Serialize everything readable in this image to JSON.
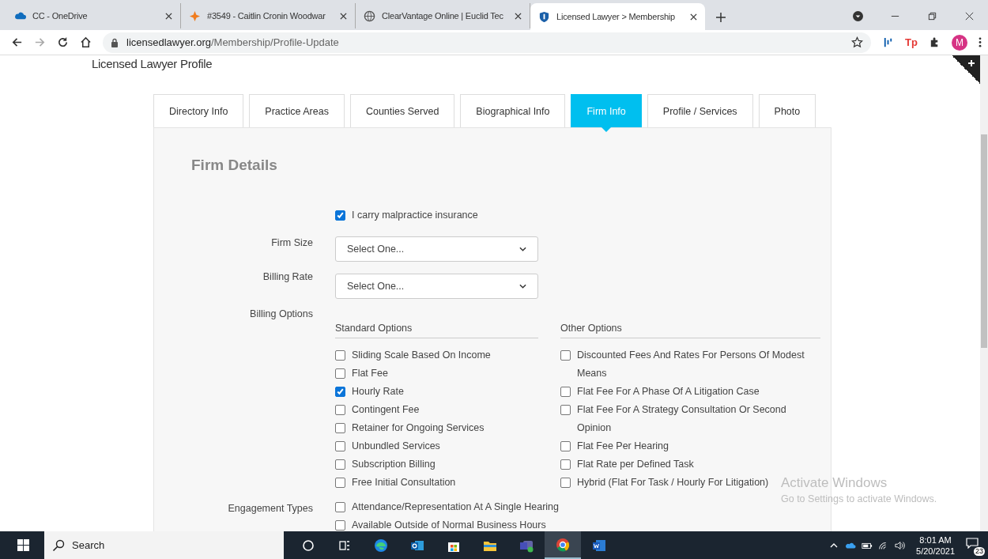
{
  "browser": {
    "tabs": [
      {
        "title": "CC - OneDrive",
        "kind": "cloud",
        "selected": false
      },
      {
        "title": "#3549 - Caitlin Cronin Woodwar",
        "kind": "spark",
        "selected": false
      },
      {
        "title": "ClearVantage Online | Euclid Tec",
        "kind": "globe",
        "selected": false
      },
      {
        "title": "Licensed Lawyer > Membership",
        "kind": "shield",
        "selected": true
      }
    ],
    "url_host": "licensedlawyer.org",
    "url_path": "/Membership/Profile-Update",
    "extension_label": "Tp",
    "profile_initial": "M"
  },
  "page": {
    "heading": "Licensed Lawyer Profile",
    "tabs": [
      {
        "label": "Directory Info",
        "selected": false
      },
      {
        "label": "Practice Areas",
        "selected": false
      },
      {
        "label": "Counties Served",
        "selected": false
      },
      {
        "label": "Biographical Info",
        "selected": false
      },
      {
        "label": "Firm Info",
        "selected": true
      },
      {
        "label": "Profile / Services",
        "selected": false
      },
      {
        "label": "Photo",
        "selected": false
      }
    ],
    "section_title": "Firm Details",
    "malpractice": {
      "label": "I carry malpractice insurance",
      "checked": true
    },
    "selects": [
      {
        "label": "Firm Size",
        "value": "Select One..."
      },
      {
        "label": "Billing Rate",
        "value": "Select One..."
      }
    ],
    "billing_options": {
      "label": "Billing Options",
      "groups": [
        {
          "title": "Standard Options",
          "options": [
            {
              "label": "Sliding Scale Based On Income",
              "checked": false
            },
            {
              "label": "Flat Fee",
              "checked": false
            },
            {
              "label": "Hourly Rate",
              "checked": true
            },
            {
              "label": "Contingent Fee",
              "checked": false
            },
            {
              "label": "Retainer for Ongoing Services",
              "checked": false
            },
            {
              "label": "Unbundled Services",
              "checked": false
            },
            {
              "label": "Subscription Billing",
              "checked": false
            },
            {
              "label": "Free Initial Consultation",
              "checked": false
            }
          ]
        },
        {
          "title": "Other Options",
          "options": [
            {
              "label": "Discounted Fees And Rates For Persons Of Modest Means",
              "checked": false
            },
            {
              "label": "Flat Fee For A Phase Of A Litigation Case",
              "checked": false
            },
            {
              "label": "Flat Fee For A Strategy Consultation Or Second Opinion",
              "checked": false
            },
            {
              "label": "Flat Fee Per Hearing",
              "checked": false
            },
            {
              "label": "Flat Rate per Defined Task",
              "checked": false
            },
            {
              "label": "Hybrid (Flat For Task / Hourly For Litigation)",
              "checked": false
            }
          ]
        }
      ]
    },
    "engagement_types": {
      "label": "Engagement Types",
      "options": [
        {
          "label": "Attendance/Representation At A Single Hearing",
          "checked": false
        },
        {
          "label": "Available Outside of Normal Business Hours",
          "checked": false
        }
      ]
    }
  },
  "activation_notice": {
    "title": "Activate Windows",
    "subtitle": "Go to Settings to activate Windows."
  },
  "taskbar": {
    "search_placeholder": "Search",
    "apps": [
      {
        "kind": "cortana",
        "selected": false
      },
      {
        "kind": "taskview",
        "selected": false
      },
      {
        "kind": "edge",
        "selected": false
      },
      {
        "kind": "outlook",
        "selected": false
      },
      {
        "kind": "store",
        "selected": false
      },
      {
        "kind": "explorer",
        "selected": false
      },
      {
        "kind": "teams",
        "selected": false
      },
      {
        "kind": "chrome",
        "selected": true
      },
      {
        "kind": "word",
        "selected": false
      }
    ],
    "time": "8:01 AM",
    "date": "5/20/2021",
    "notification_count": "23"
  }
}
